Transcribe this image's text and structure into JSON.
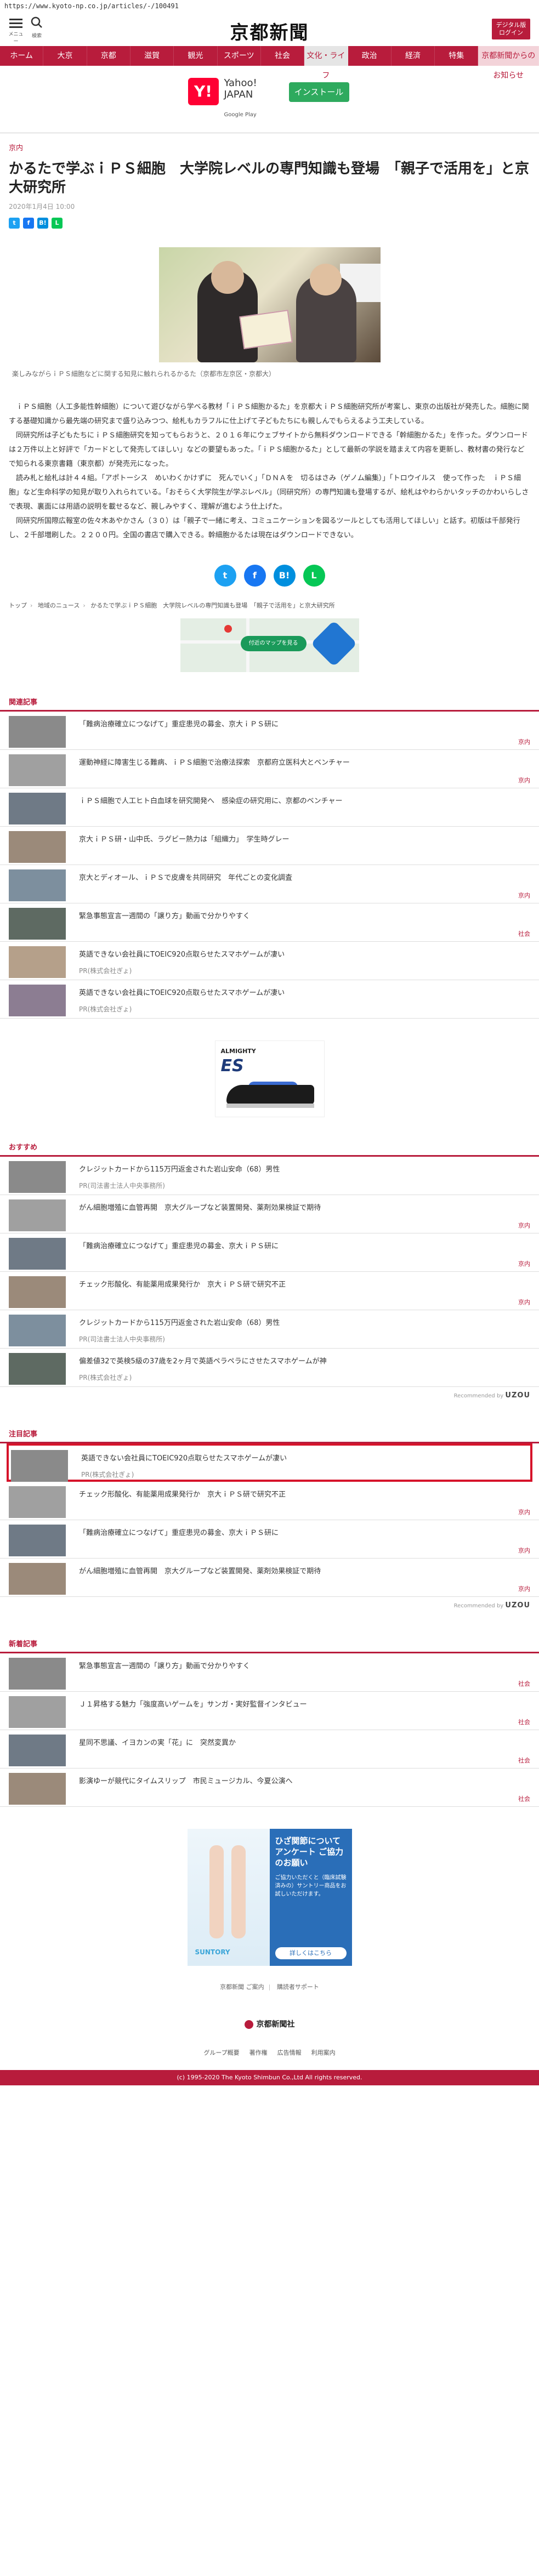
{
  "url": "https://www.kyoto-np.co.jp/articles/-/100491",
  "header": {
    "menu_label": "メニュー",
    "search_label": "検索",
    "logo": "京都新聞",
    "digital_label_1": "デジタル版",
    "digital_label_2": "ログイン"
  },
  "nav": [
    {
      "label": "ホーム"
    },
    {
      "label": "大京"
    },
    {
      "label": "京都"
    },
    {
      "label": "滋賀"
    },
    {
      "label": "観光"
    },
    {
      "label": "スポーツ"
    },
    {
      "label": "社会"
    },
    {
      "label": "文化・ライフ"
    },
    {
      "label": "政治"
    },
    {
      "label": "経済"
    },
    {
      "label": "特集"
    },
    {
      "label": "京都新聞からのお知らせ"
    }
  ],
  "app_banner": {
    "logo": "Y!",
    "title_1": "Yahoo!",
    "title_2": "JAPAN",
    "store": "Google Play",
    "install": "インストール"
  },
  "article": {
    "category": "京内",
    "headline": "かるたで学ぶｉＰＳ細胞　大学院レベルの専門知識も登場　「親子で活用を」と京大研究所",
    "date": "2020年1月4日 10:00",
    "share_small": [
      "t",
      "f",
      "B!",
      "L"
    ],
    "caption": "楽しみながらｉＰＳ細胞などに関する知見に触れられるかるた（京都市左京区・京都大）",
    "paragraphs": [
      "ｉＰＳ細胞（人工多能性幹細胞）について遊びながら学べる教材「ｉＰＳ細胞かるた」を京都大ｉＰＳ細胞研究所が考案し、東京の出版社が発売した。細胞に関する基礎知識から最先端の研究まで盛り込みつつ、絵札もカラフルに仕上げて子どもたちにも親しんでもらえるよう工夫している。",
      "同研究所は子どもたちにｉＰＳ細胞研究を知ってもらおうと、２０１６年にウェブサイトから無料ダウンロードできる「幹細胞かるた」を作った。ダウンロードは２万件以上と好評で「カードとして発売してほしい」などの要望もあった。「ｉＰＳ細胞かるた」として最新の学説を踏まえて内容を更新し、教材書の発行などで知られる東京書籍（東京都）が発売元になった。",
      "読み札と絵札は計４４組。「アポトーシス　めいわくかけずに　死んでいく」「ＤＮＡを　切るはさみ（ゲノム編集）」「トロウイルス　使って作った　ｉＰＳ細胞」など生命科学の知見が取り入れられている。「おそらく大学院生が学ぶレベル」（同研究所）の専門知識も登場するが、絵札はやわらかいタッチのかわいらしさで表現、裏面には用語の説明を載せるなど、親しみやすく、理解が進むよう仕上げた。",
      "同研究所国際広報室の佐々木あやかさん（３０）は「親子で一緒に考え、コミュニケーションを図るツールとしても活用してほしい」と話す。初版は千部発行し、２千部増刷した。２２００円。全国の書店で購入できる。幹細胞かるたは現在はダウンロードできない。"
    ],
    "share_big": [
      "t",
      "f",
      "B!",
      "L"
    ]
  },
  "breadcrumb": [
    "トップ",
    "地域のニュース",
    "かるたで学ぶｉＰＳ細胞　大学院レベルの専門知識も登場　「親子で活用を」と京大研究所"
  ],
  "map_ad": {
    "label": "付近のマップを見る"
  },
  "related": {
    "title": "関連記事",
    "items": [
      {
        "title": "「難病治療確立につなげて」重症患児の募金、京大ｉＰＳ研に",
        "tag": "京内"
      },
      {
        "title": "運動神経に障害生じる難病、ｉＰＳ細胞で治療法探索　京都府立医科大とベンチャー",
        "tag": "京内"
      },
      {
        "title": "ｉＰＳ細胞で人工ヒト白血球を研究開発へ　感染症の研究用に、京都のベンチャー",
        "tag": ""
      },
      {
        "title": "京大ｉＰＳ研・山中氏、ラグビー熱力は「組織力」　学生時グレー",
        "tag": ""
      },
      {
        "title": "京大とディオール、ｉＰＳで皮膚を共同研究　年代ごとの変化調査",
        "tag": "京内"
      },
      {
        "title": "緊急事態宣言一週間の「譲り方」動画で分かりやすく",
        "tag": "社会"
      },
      {
        "title": "英語できない会社員にTOEIC920点取らせたスマホゲームが凄い",
        "pr": "PR(株式会社ぎょ)",
        "tag": ""
      },
      {
        "title": "英語できない会社員にTOEIC920点取らせたスマホゲームが凄い",
        "pr": "PR(株式会社ぎょ)",
        "tag": ""
      }
    ]
  },
  "ad_shoe": {
    "brand": "ALMIGHTY",
    "model": "ES"
  },
  "recommend_section": {
    "title": "おすすめ",
    "items": [
      {
        "title": "クレジットカードから115万円返金された岩山安命（68）男性",
        "pr": "PR(司法書士法人中央事務所)",
        "tag": ""
      },
      {
        "title": "がん細胞増殖に血管再開　京大グループなど装置開発、薬剤効果検証で期待",
        "tag": "京内"
      },
      {
        "title": "「難病治療確立につなげて」重症患児の募金、京大ｉＰＳ研に",
        "tag": "京内"
      },
      {
        "title": "チェック形酸化、有能薬用成果発行か　京大ｉＰＳ研で研究不正",
        "tag": "京内"
      },
      {
        "title": "クレジットカードから115万円返金された岩山安命（68）男性",
        "pr": "PR(司法書士法人中央事務所)",
        "tag": ""
      },
      {
        "title": "偏差値32で英検5級の37歳を2ヶ月で英語ペラペラにさせたスマホゲームが神",
        "pr": "PR(株式会社ぎょ)",
        "tag": ""
      }
    ],
    "footer": "Recommended by",
    "footer_brand": "UZOU"
  },
  "featured": {
    "title": "注目記事",
    "items": [
      {
        "title": "英語できない会社員にTOEIC920点取らせたスマホゲームが凄い",
        "pr": "PR(株式会社ぎょ)",
        "tag": ""
      },
      {
        "title": "チェック形酸化、有能薬用成果発行か　京大ｉＰＳ研で研究不正",
        "tag": "京内"
      },
      {
        "title": "「難病治療確立につなげて」重症患児の募金、京大ｉＰＳ研に",
        "tag": "京内"
      },
      {
        "title": "がん細胞増殖に血管再開　京大グループなど装置開発、薬剤効果検証で期待",
        "tag": "京内"
      }
    ],
    "footer": "Recommended by",
    "footer_brand": "UZOU"
  },
  "latest": {
    "title": "新着記事",
    "items": [
      {
        "title": "緊急事態宣言一週間の「譲り方」動画で分かりやすく",
        "tag": "社会"
      },
      {
        "title": "Ｊ１昇格する魅力「強度高いゲームを」サンガ・実好監督インタビュー",
        "tag": "社会"
      },
      {
        "title": "星同不思議、イヨカンの実「花」に　突然変異か",
        "tag": "社会"
      },
      {
        "title": "影演ゆーが競代にタイムスリップ　市民ミュージカル、今夏公演へ",
        "tag": "社会"
      }
    ]
  },
  "ad_survey": {
    "headline": "ひざ関節について アンケート ご協力のお願い",
    "body": "ご協力いただくと（臨床試験済みの）サントリー商品をお試しいただけます。",
    "cta": "詳しくはこちら",
    "brand": "SUNTORY"
  },
  "footer": {
    "links": [
      "京都新聞 ご案内",
      "購読者サポート"
    ],
    "logo": "京都新聞社",
    "nav": [
      "グループ概要",
      "著作権",
      "広告情報",
      "利用案内"
    ],
    "copyright": "(c) 1995-2020 The Kyoto Shimbun Co.,Ltd All rights reserved."
  }
}
